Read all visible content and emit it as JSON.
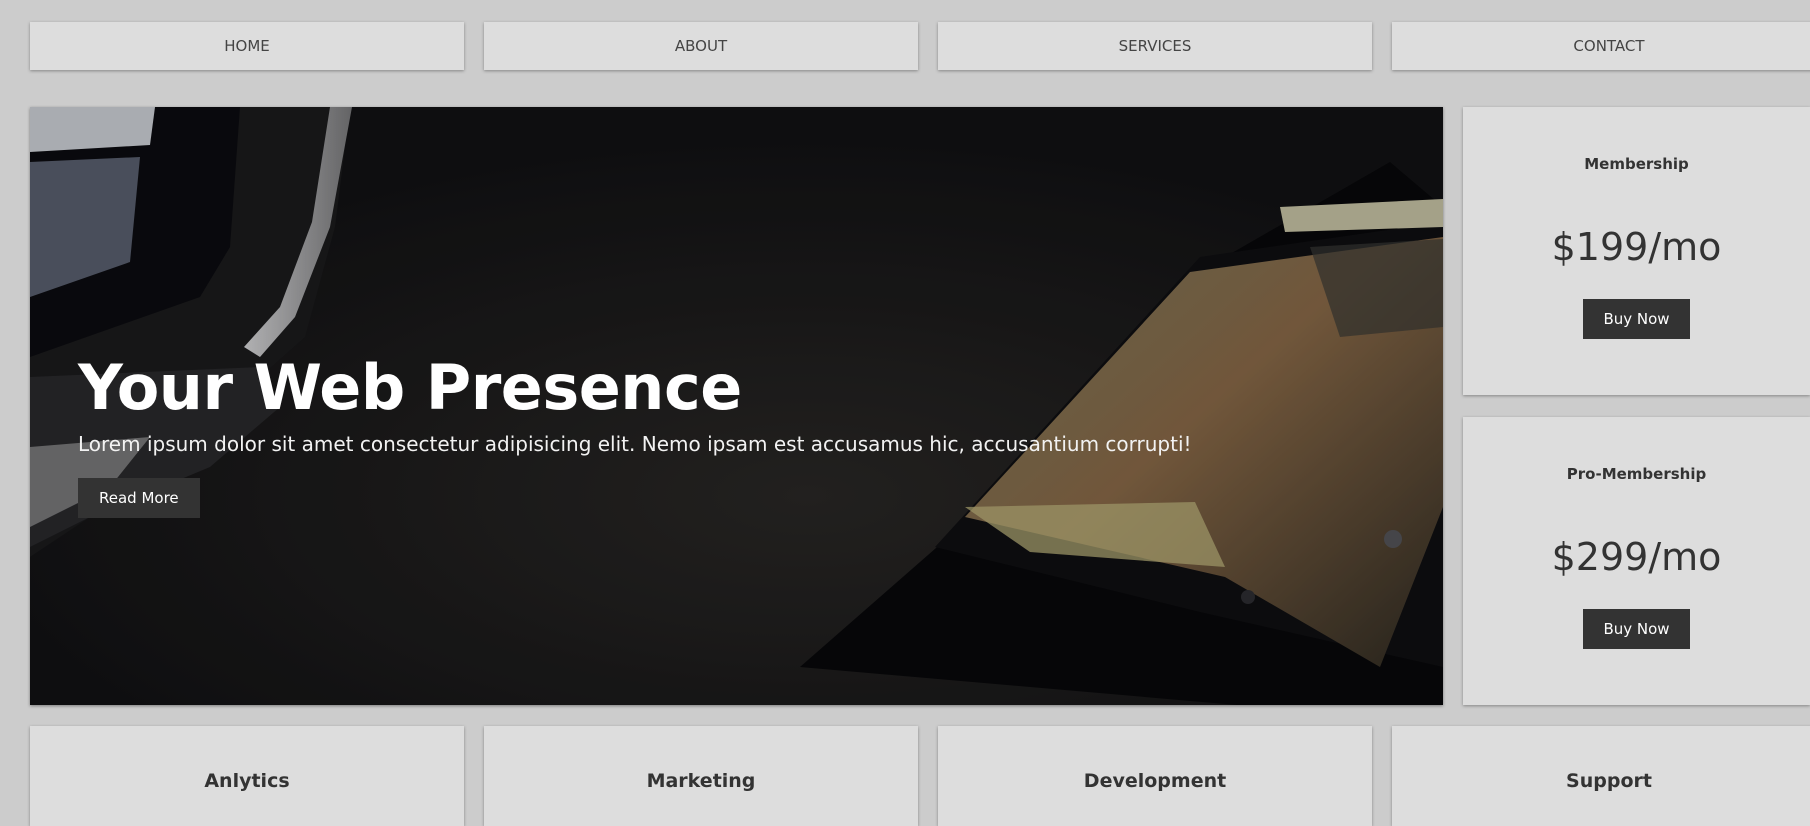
{
  "nav": {
    "items": [
      {
        "label": "HOME"
      },
      {
        "label": "ABOUT"
      },
      {
        "label": "SERVICES"
      },
      {
        "label": "CONTACT"
      }
    ]
  },
  "hero": {
    "title": "Your Web Presence",
    "text": "Lorem ipsum dolor sit amet consectetur adipisicing elit. Nemo ipsam est accusamus hic, accusantium corrupti!",
    "button_label": "Read More"
  },
  "plans": [
    {
      "name": "Membership",
      "price": "$199/mo",
      "button_label": "Buy Now"
    },
    {
      "name": "Pro-Membership",
      "price": "$299/mo",
      "button_label": "Buy Now"
    }
  ],
  "boxes": [
    {
      "title": "Anlytics"
    },
    {
      "title": "Marketing"
    },
    {
      "title": "Development"
    },
    {
      "title": "Support"
    }
  ],
  "colors": {
    "page_background": "#cccccc",
    "card_background": "#dddddd",
    "button_background": "#333333",
    "hero_background": "#131315"
  }
}
